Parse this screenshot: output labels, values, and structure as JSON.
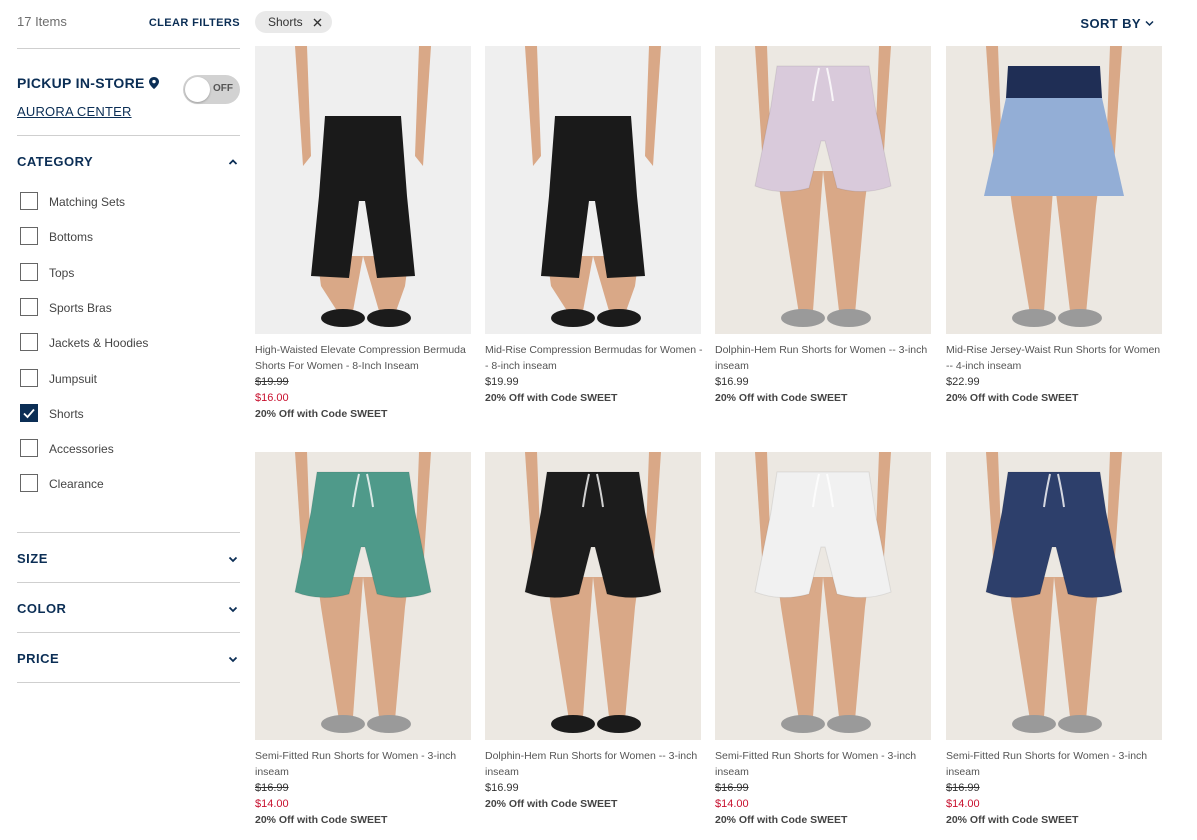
{
  "items_count": "17 Items",
  "clear_filters": "CLEAR FILTERS",
  "pickup": {
    "title": "PICKUP IN-STORE",
    "store": "AURORA CENTER",
    "toggle_label": "OFF"
  },
  "category": {
    "title": "CATEGORY",
    "items": [
      {
        "label": "Matching Sets",
        "checked": false
      },
      {
        "label": "Bottoms",
        "checked": false
      },
      {
        "label": "Tops",
        "checked": false
      },
      {
        "label": "Sports Bras",
        "checked": false
      },
      {
        "label": "Jackets & Hoodies",
        "checked": false
      },
      {
        "label": "Jumpsuit",
        "checked": false
      },
      {
        "label": "Shorts",
        "checked": true
      },
      {
        "label": "Accessories",
        "checked": false
      },
      {
        "label": "Clearance",
        "checked": false
      }
    ]
  },
  "filters": {
    "size": "SIZE",
    "color": "COLOR",
    "price": "PRICE"
  },
  "active_filter": "Shorts",
  "sort_by": "SORT BY",
  "products": [
    {
      "name": "High-Waisted Elevate Compression Bermuda Shorts For Women - 8-Inch Inseam",
      "original_price": "$19.99",
      "sale_price": "$16.00",
      "promo": "20% Off with Code SWEET",
      "short_color": "#1a1a1a",
      "bg": "#efefef",
      "style": "bike"
    },
    {
      "name": "Mid-Rise Compression Bermudas for Women -- 8-inch inseam",
      "price": "$19.99",
      "promo": "20% Off with Code SWEET",
      "short_color": "#1a1a1a",
      "bg": "#efefef",
      "style": "bike"
    },
    {
      "name": "Dolphin-Hem Run Shorts for Women -- 3-inch inseam",
      "price": "$16.99",
      "promo": "20% Off with Code SWEET",
      "short_color": "#d9cadb",
      "bg": "#ece8e2",
      "style": "run"
    },
    {
      "name": "Mid-Rise Jersey-Waist Run Shorts for Women -- 4-inch inseam",
      "price": "$22.99",
      "promo": "20% Off with Code SWEET",
      "short_color": "#93aed6",
      "bg": "#ece8e2",
      "style": "skirt"
    },
    {
      "name": "Semi-Fitted Run Shorts for Women - 3-inch inseam",
      "original_price": "$16.99",
      "sale_price": "$14.00",
      "promo": "20% Off with Code SWEET",
      "short_color": "#4f9a8a",
      "bg": "#ece8e2",
      "style": "run"
    },
    {
      "name": "Dolphin-Hem Run Shorts for Women -- 3-inch inseam",
      "price": "$16.99",
      "promo": "20% Off with Code SWEET",
      "short_color": "#1c1c1c",
      "bg": "#ece8e2",
      "style": "run"
    },
    {
      "name": "Semi-Fitted Run Shorts for Women - 3-inch inseam",
      "original_price": "$16.99",
      "sale_price": "$14.00",
      "promo": "20% Off with Code SWEET",
      "short_color": "#f1f1f1",
      "bg": "#ece8e2",
      "style": "run"
    },
    {
      "name": "Semi-Fitted Run Shorts for Women - 3-inch inseam",
      "original_price": "$16.99",
      "sale_price": "$14.00",
      "promo": "20% Off with Code SWEET",
      "short_color": "#2d3f6b",
      "bg": "#ece8e2",
      "style": "run"
    }
  ]
}
